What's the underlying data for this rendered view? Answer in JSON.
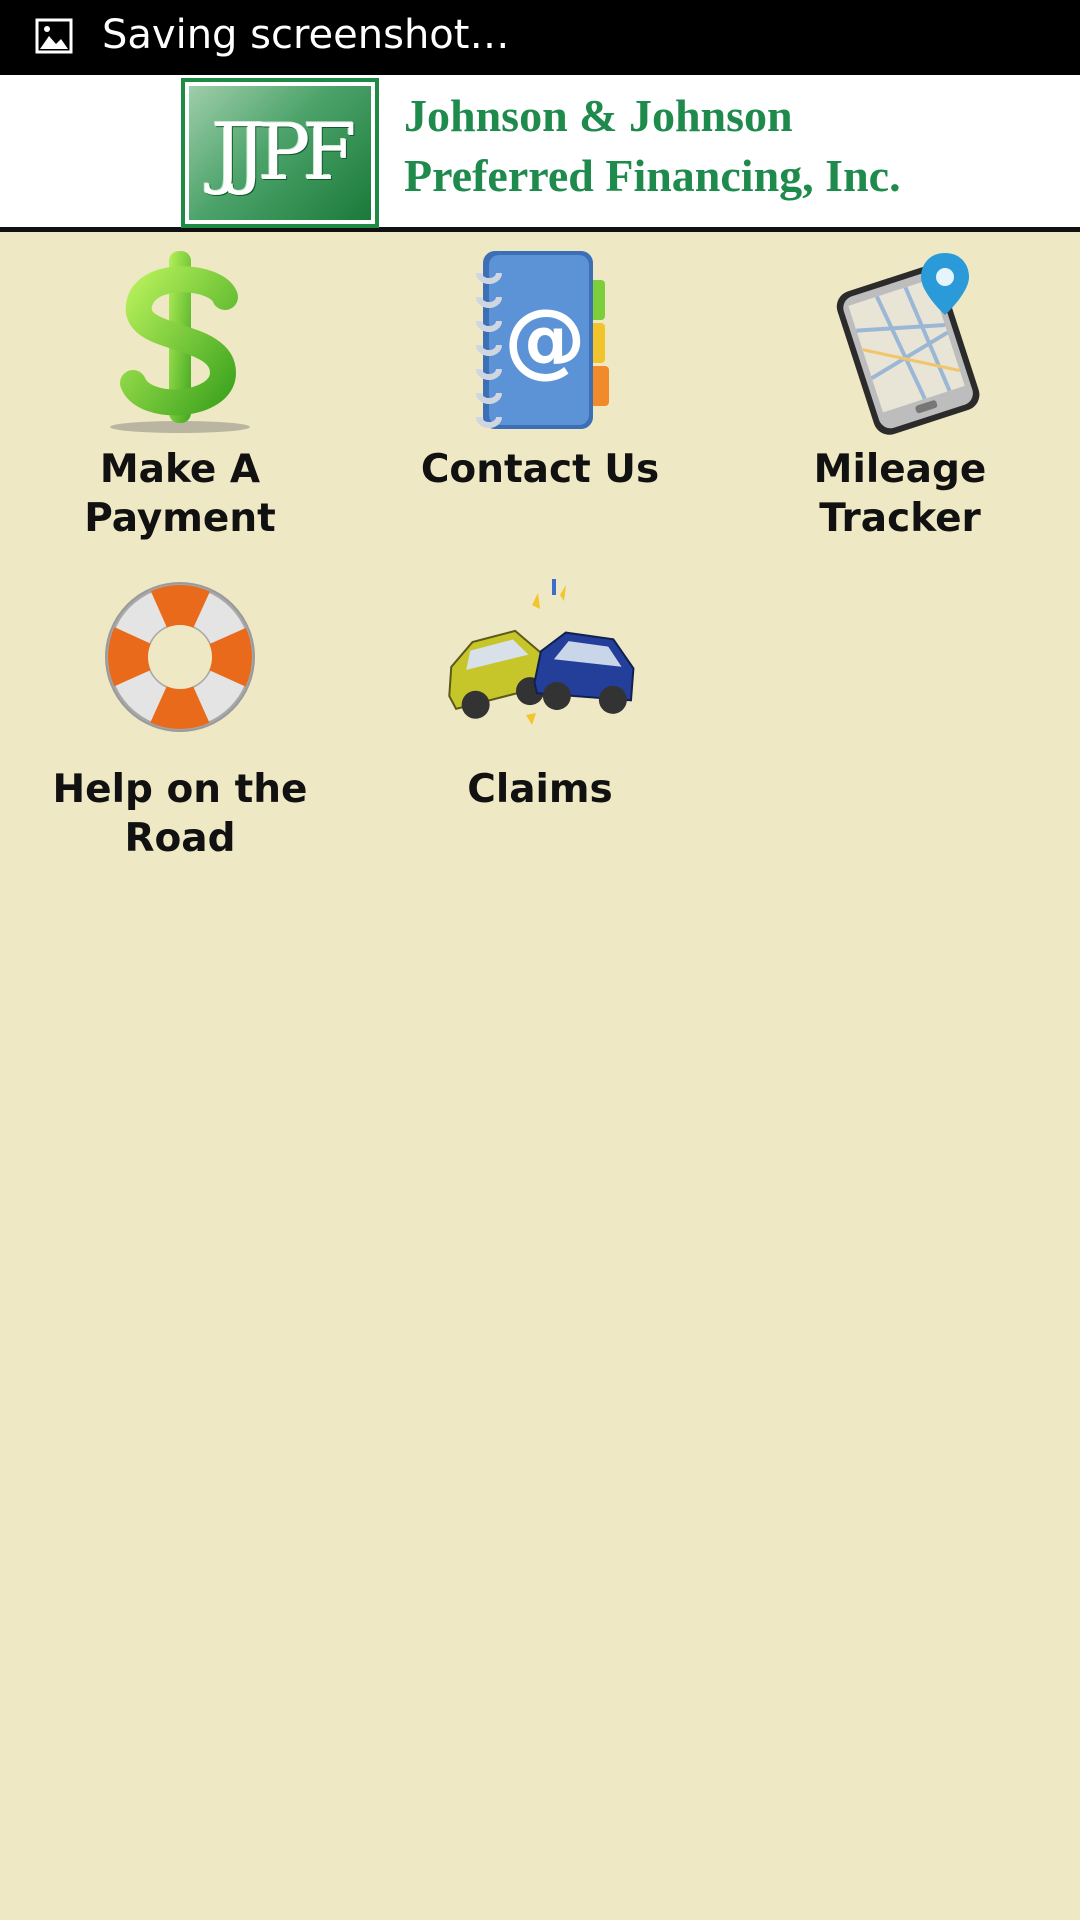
{
  "status_bar": {
    "text": "Saving screenshot…",
    "icon": "image-icon"
  },
  "header": {
    "logo_letters": "JJPF",
    "company_name_line1": "Johnson & Johnson",
    "company_name_line2": "Preferred Financing, Inc.",
    "brand_color": "#1e8a4c"
  },
  "menu": {
    "items": [
      {
        "label": "Make A\nPayment",
        "label_line1": "Make A",
        "label_line2": "Payment",
        "icon": "dollar-icon"
      },
      {
        "label_line1": "Contact Us",
        "label_line2": "",
        "icon": "address-book-icon"
      },
      {
        "label_line1": "Mileage",
        "label_line2": "Tracker",
        "icon": "map-phone-icon"
      },
      {
        "label_line1": "Help on the",
        "label_line2": "Road",
        "icon": "life-ring-icon"
      },
      {
        "label_line1": "Claims",
        "label_line2": "",
        "icon": "car-crash-icon"
      }
    ]
  },
  "colors": {
    "background": "#efe8c4",
    "status_bar": "#000000",
    "header_bg": "#ffffff"
  }
}
